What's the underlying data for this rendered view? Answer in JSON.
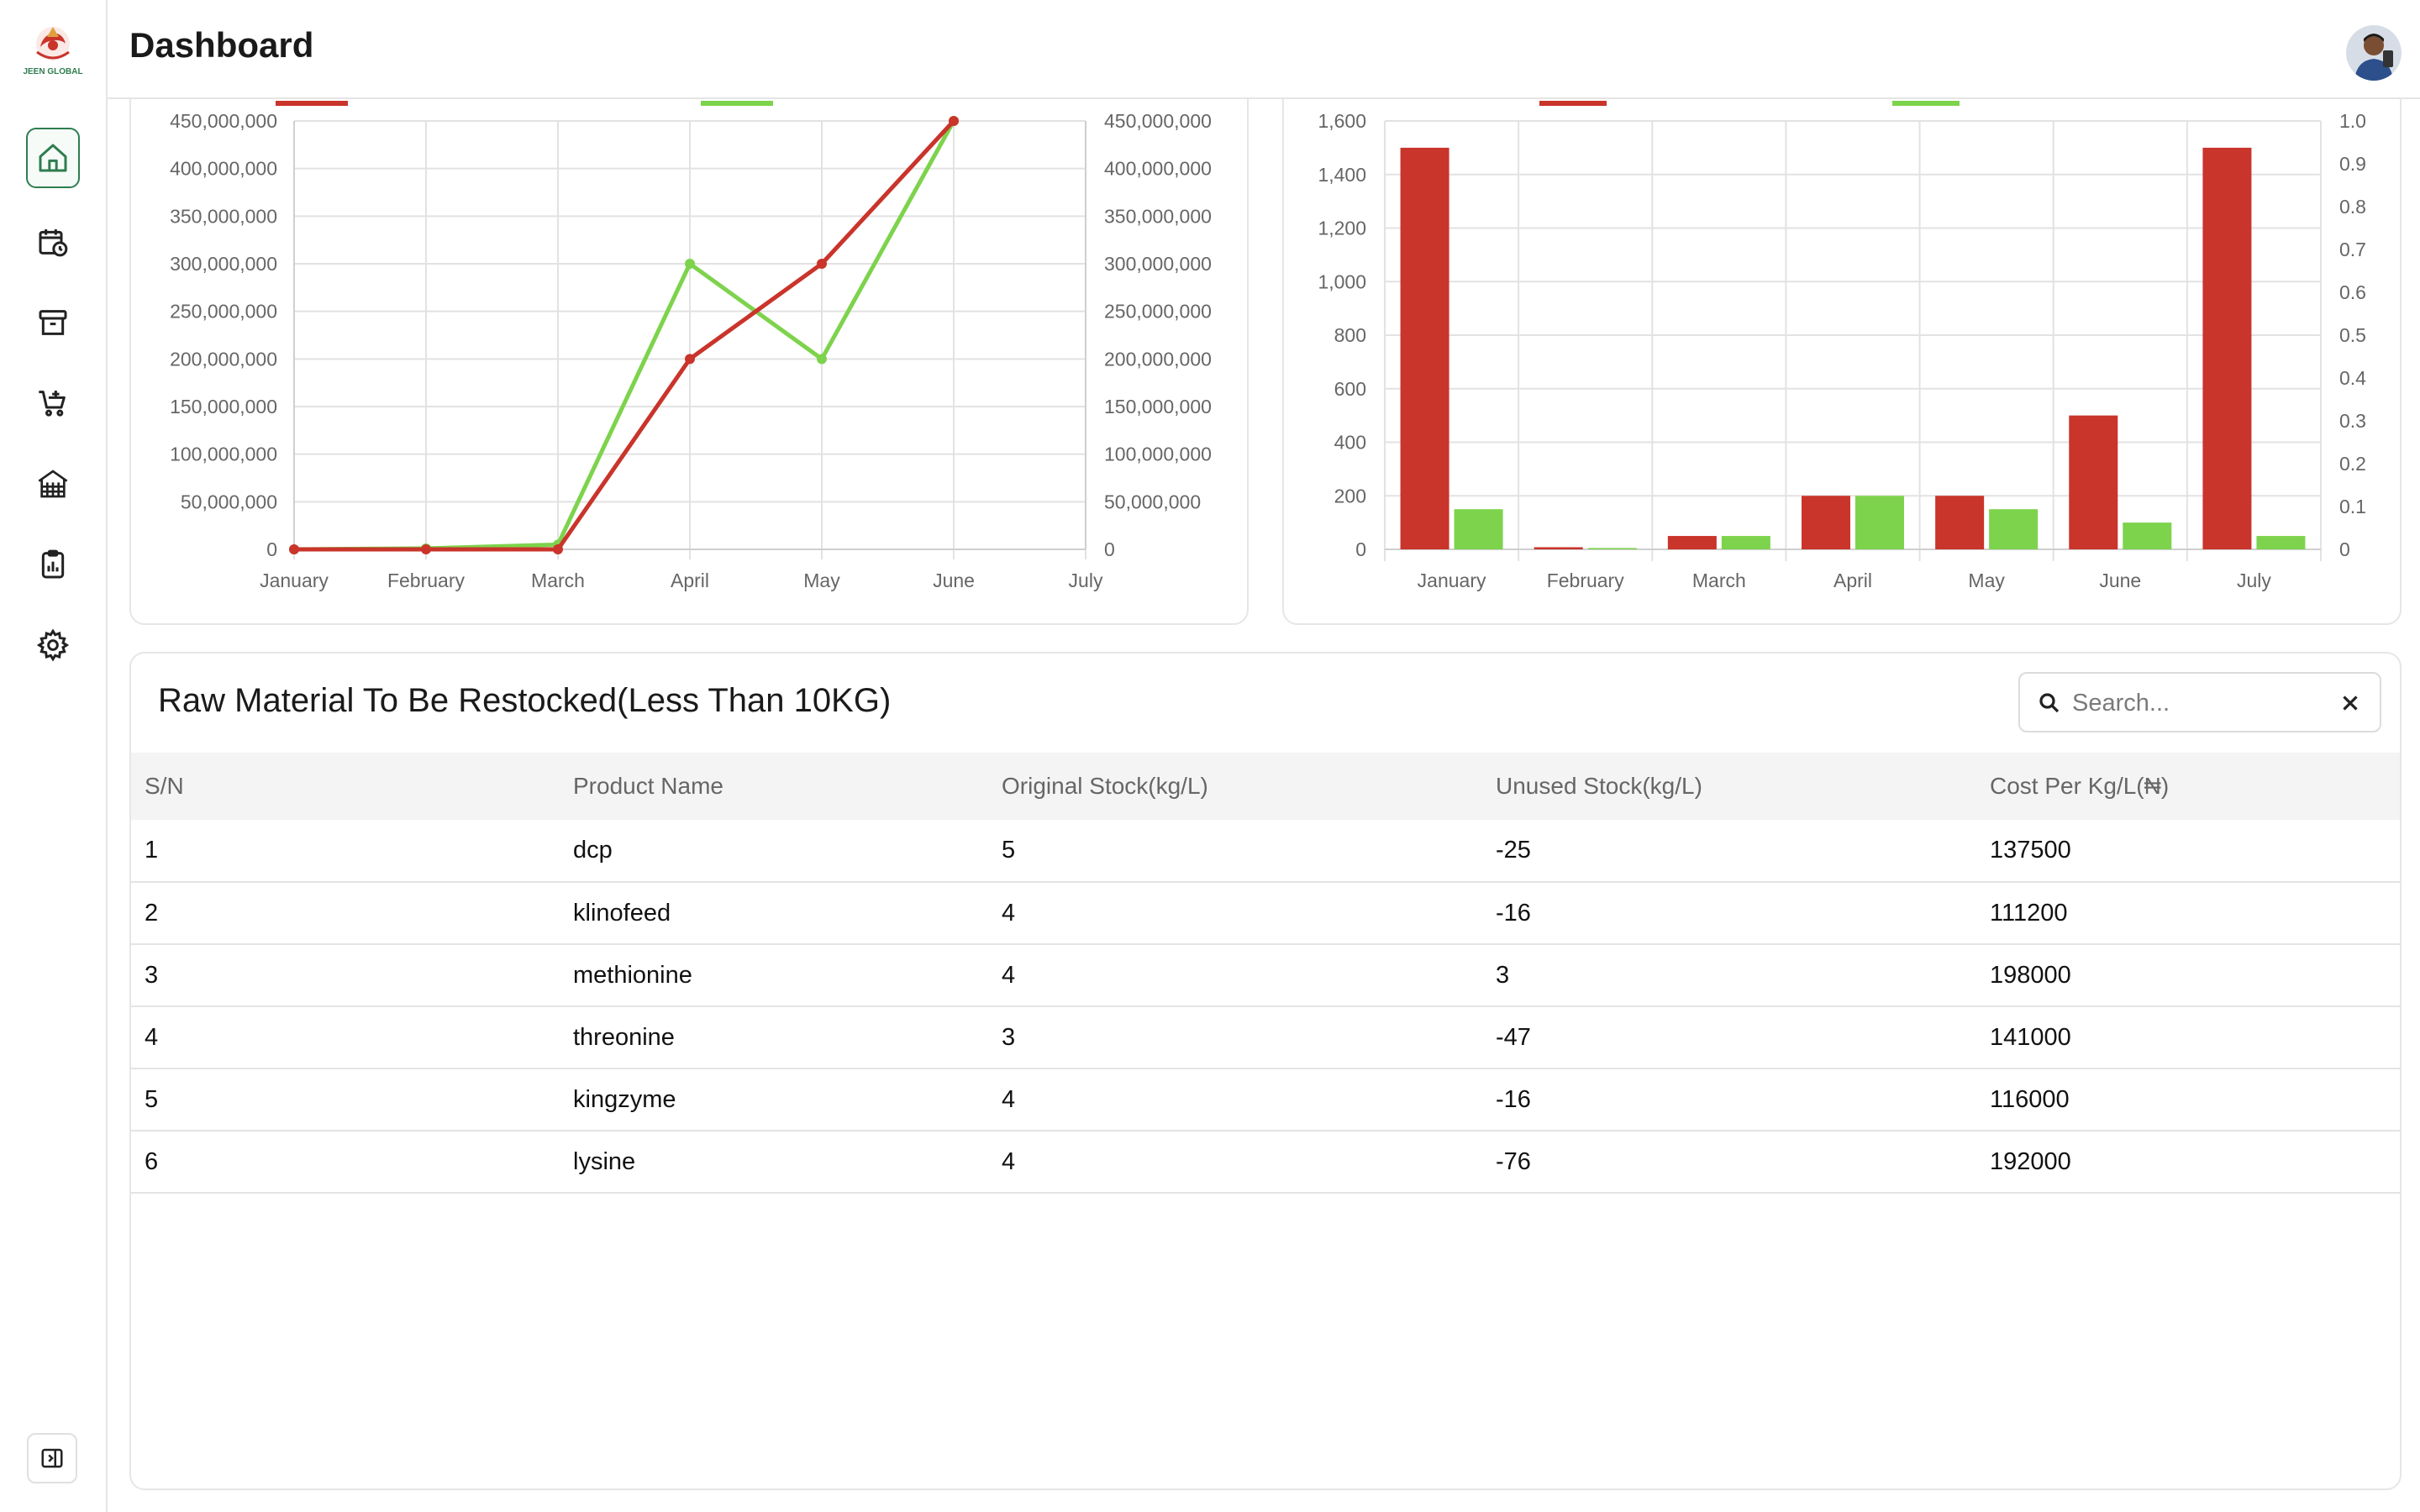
{
  "header": {
    "title": "Dashboard"
  },
  "sidebar": {
    "logo_text": "JEEN GLOBAL",
    "items": [
      {
        "icon": "home-icon",
        "active": true
      },
      {
        "icon": "calendar-clock-icon",
        "active": false
      },
      {
        "icon": "archive-icon",
        "active": false
      },
      {
        "icon": "cart-add-icon",
        "active": false
      },
      {
        "icon": "poultry-house-icon",
        "active": false
      },
      {
        "icon": "clipboard-report-icon",
        "active": false
      },
      {
        "icon": "gear-icon",
        "active": false
      }
    ],
    "collapse_icon": "sidebar-collapse-icon"
  },
  "colors": {
    "red": "#c9342b",
    "green": "#7dd34c",
    "accent": "#2e7d4f"
  },
  "chart_data": [
    {
      "type": "line",
      "categories": [
        "January",
        "February",
        "March",
        "April",
        "May",
        "June",
        "July"
      ],
      "series": [
        {
          "color": "#7dd34c",
          "values": [
            0,
            1000000,
            5000000,
            300000000,
            200000000,
            450000000
          ]
        },
        {
          "color": "#c9342b",
          "values": [
            0,
            0,
            0,
            200000000,
            300000000,
            450000000
          ]
        }
      ],
      "ylim": [
        0,
        450000000
      ],
      "yticks": [
        "0",
        "50,000,000",
        "100,000,000",
        "150,000,000",
        "200,000,000",
        "250,000,000",
        "300,000,000",
        "350,000,000",
        "400,000,000",
        "450,000,000"
      ],
      "y2ticks": [
        "0",
        "50,000,000",
        "100,000,000",
        "150,000,000",
        "200,000,000",
        "250,000,000",
        "300,000,000",
        "350,000,000",
        "400,000,000",
        "450,000,000"
      ],
      "grid": true,
      "legend": "top (partially hidden)"
    },
    {
      "type": "bar",
      "categories": [
        "January",
        "February",
        "March",
        "April",
        "May",
        "June",
        "July"
      ],
      "series": [
        {
          "color": "#c9342b",
          "values": [
            1500,
            8,
            50,
            200,
            200,
            500,
            1500
          ]
        },
        {
          "color": "#7dd34c",
          "values": [
            150,
            5,
            50,
            200,
            150,
            100,
            50
          ]
        }
      ],
      "ylim": [
        0,
        1600
      ],
      "yticks": [
        "0",
        "200",
        "400",
        "600",
        "800",
        "1,000",
        "1,200",
        "1,400",
        "1,600"
      ],
      "y2lim": [
        0,
        1
      ],
      "y2ticks": [
        "0",
        "0.1",
        "0.2",
        "0.3",
        "0.4",
        "0.5",
        "0.6",
        "0.7",
        "0.8",
        "0.9",
        "1.0"
      ],
      "grid": true,
      "legend": "top (partially hidden)"
    }
  ],
  "table": {
    "title": "Raw Material To Be Restocked(Less Than 10KG)",
    "search_placeholder": "Search...",
    "columns": [
      "S/N",
      "Product Name",
      "Original Stock(kg/L)",
      "Unused Stock(kg/L)",
      "Cost Per Kg/L(₦)"
    ],
    "rows": [
      [
        "1",
        "dcp",
        "5",
        "-25",
        "137500"
      ],
      [
        "2",
        "klinofeed",
        "4",
        "-16",
        "111200"
      ],
      [
        "3",
        "methionine",
        "4",
        "3",
        "198000"
      ],
      [
        "4",
        "threonine",
        "3",
        "-47",
        "141000"
      ],
      [
        "5",
        "kingzyme",
        "4",
        "-16",
        "116000"
      ],
      [
        "6",
        "lysine",
        "4",
        "-76",
        "192000"
      ]
    ]
  }
}
